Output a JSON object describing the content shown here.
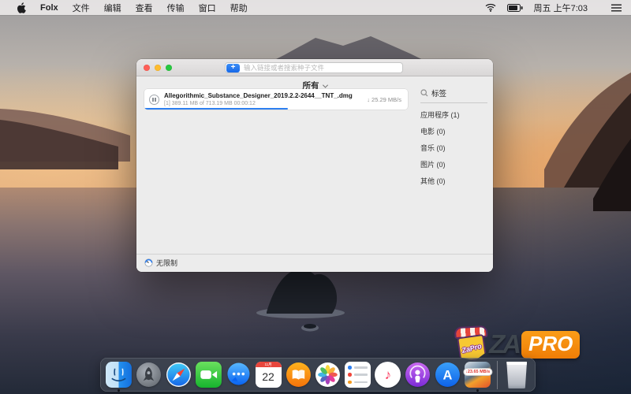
{
  "menu_bar": {
    "app_name": "Folx",
    "menus": [
      "文件",
      "编辑",
      "查看",
      "传输",
      "窗口",
      "帮助"
    ],
    "clock": "周五 上午7:03"
  },
  "window": {
    "toolbar": {
      "add_button": "+",
      "search_placeholder": "输入链接或者搜索种子文件"
    },
    "filter": {
      "label": "所有"
    },
    "download": {
      "filename": "Allegorithmic_Substance_Designer_2019.2.2-2644__TNT_.dmg",
      "details": "[1] 389.11 MB of 713.19 MB  00:00:12",
      "speed": "↓ 25.29 MB/s",
      "progress_percent": 54.6
    },
    "tags": {
      "header": "标签",
      "items": [
        {
          "label": "应用程序 (1)"
        },
        {
          "label": "电影 (0)"
        },
        {
          "label": "音乐 (0)"
        },
        {
          "label": "图片 (0)"
        },
        {
          "label": "其他 (0)"
        }
      ]
    },
    "statusbar": {
      "speed_mode": "无限制"
    }
  },
  "dock": {
    "apps": [
      "finder",
      "launchpad",
      "safari",
      "facetime",
      "messages",
      "calendar",
      "books",
      "photos",
      "reminders",
      "music",
      "podcasts",
      "app-store",
      "folx",
      "trash"
    ],
    "calendar": {
      "month": "11月",
      "day": "22"
    },
    "music_glyph": "♪",
    "appstore_letter": "A",
    "folx_badge": "↓23.65 MB/s"
  },
  "watermark": {
    "store_label": "ZaPro",
    "za": "ZA",
    "pro": "PRO"
  },
  "colors": {
    "accent_blue": "#2d7ff0",
    "badge_orange": "#ef7d06",
    "dock_badge_red": "#e0342b",
    "traffic_red": "#ff5f57",
    "traffic_yellow": "#febc2e",
    "traffic_green": "#28c840"
  }
}
